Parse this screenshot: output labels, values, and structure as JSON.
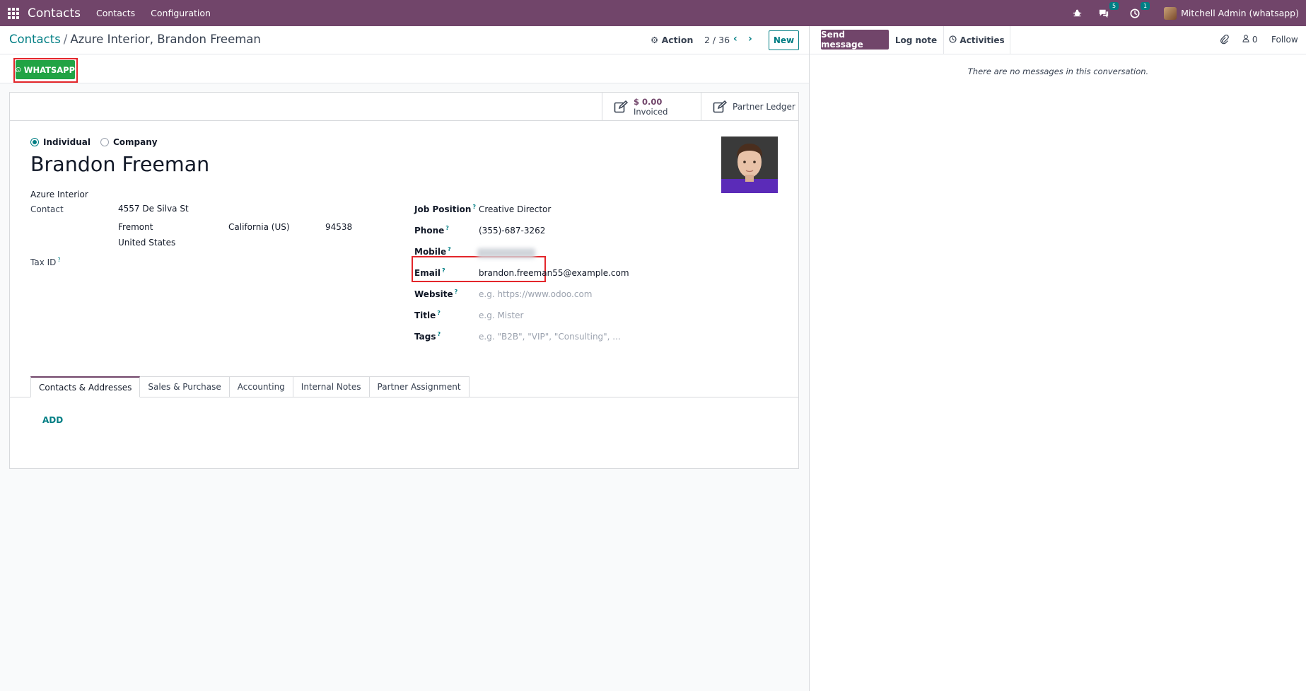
{
  "navbar": {
    "brand": "Contacts",
    "menu": [
      "Contacts",
      "Configuration"
    ],
    "messages_count": "5",
    "activities_count": "1",
    "user": "Mitchell Admin (whatsapp)"
  },
  "breadcrumb": {
    "parent": "Contacts",
    "separator": "/",
    "current": "Azure Interior, Brandon Freeman"
  },
  "control": {
    "action_label": "Action",
    "pager": "2 / 36",
    "new_label": "New"
  },
  "statusbar": {
    "whatsapp_label": "WHATSAPP"
  },
  "stat_buttons": {
    "invoiced_value": "$ 0.00",
    "invoiced_label": "Invoiced",
    "ledger_label": "Partner Ledger"
  },
  "form": {
    "type_individual": "Individual",
    "type_company": "Company",
    "name": "Brandon Freeman",
    "company": "Azure Interior",
    "contact_label": "Contact",
    "street": "4557 De Silva St",
    "city": "Fremont",
    "state": "California (US)",
    "zip": "94538",
    "country": "United States",
    "tax_id_label": "Tax ID",
    "job_position_label": "Job Position",
    "job_position": "Creative Director",
    "phone_label": "Phone",
    "phone": "(355)-687-3262",
    "mobile_label": "Mobile",
    "email_label": "Email",
    "email": "brandon.freeman55@example.com",
    "website_label": "Website",
    "website_placeholder": "e.g. https://www.odoo.com",
    "title_label": "Title",
    "title_placeholder": "e.g. Mister",
    "tags_label": "Tags",
    "tags_placeholder": "e.g. \"B2B\", \"VIP\", \"Consulting\", ...",
    "help_mark": "?"
  },
  "tabs": [
    "Contacts & Addresses",
    "Sales & Purchase",
    "Accounting",
    "Internal Notes",
    "Partner Assignment"
  ],
  "add_label": "ADD",
  "chatter": {
    "send_message": "Send message",
    "log_note": "Log note",
    "activities": "Activities",
    "followers_count": "0",
    "follow": "Follow",
    "no_messages": "There are no messages in this conversation."
  },
  "colors": {
    "brand": "#71456a",
    "accent": "#017e84",
    "whatsapp": "#21a344",
    "highlight": "#e3262b"
  }
}
